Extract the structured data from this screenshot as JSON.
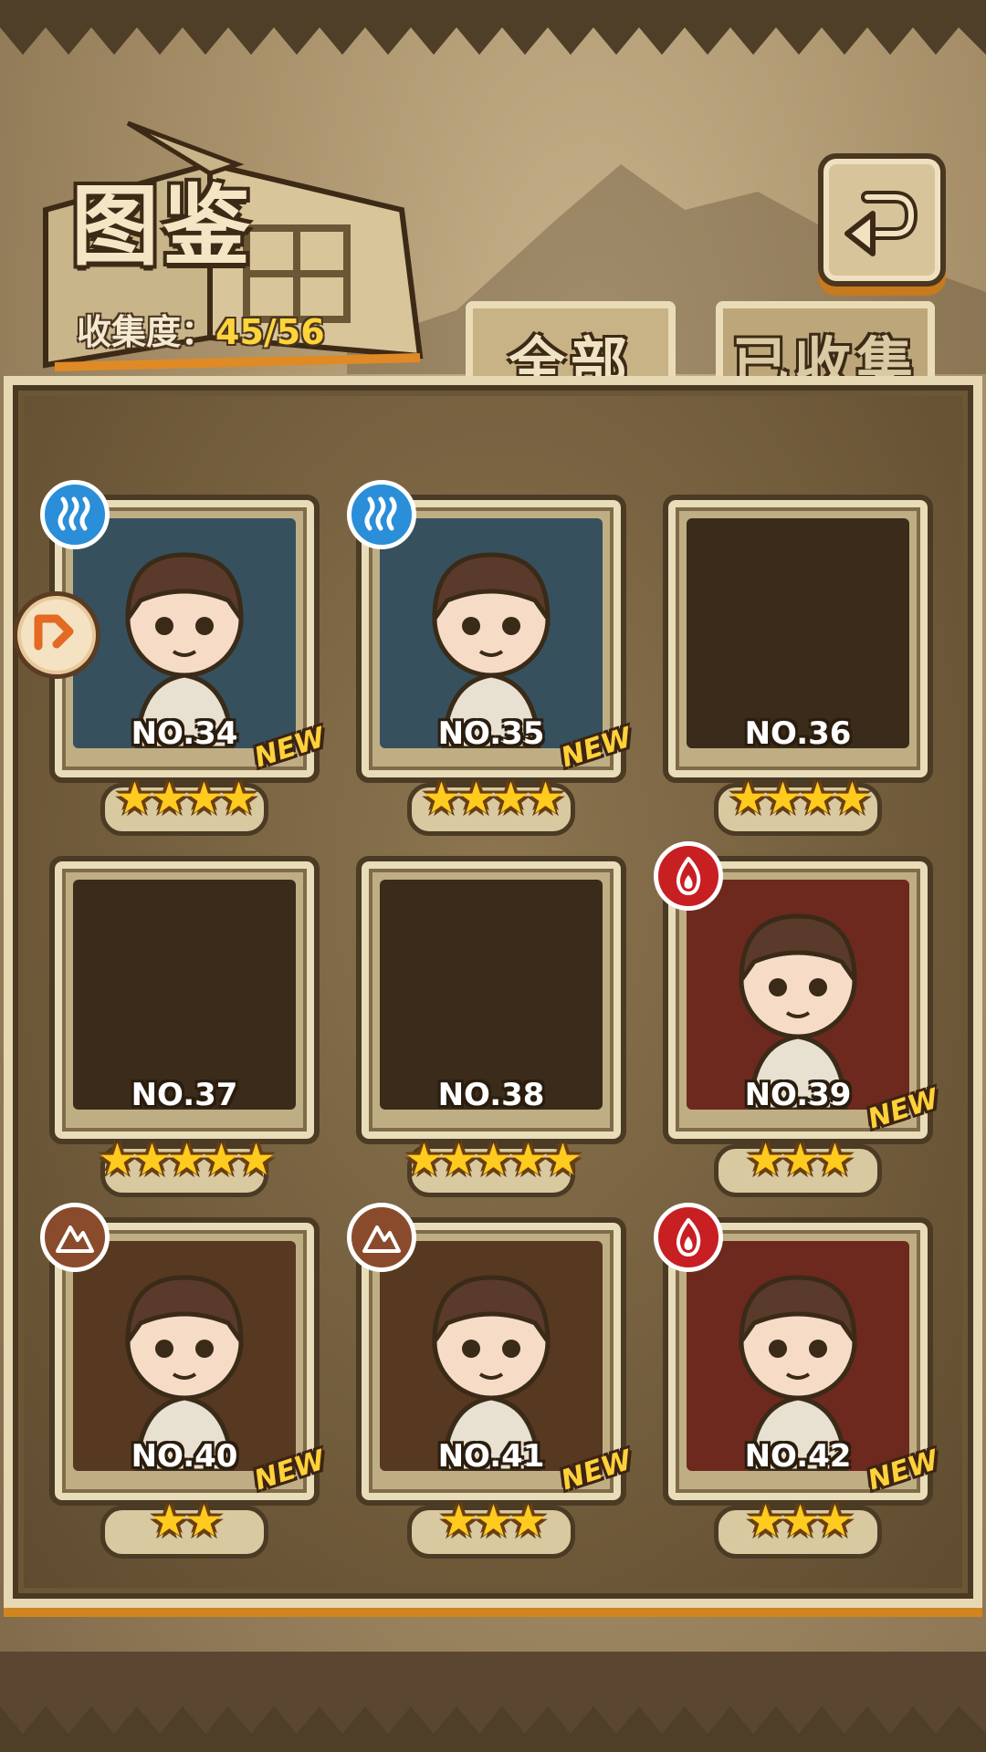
{
  "header": {
    "title": "图鉴",
    "collection_label": "收集度：",
    "collection_value": "45/56"
  },
  "tabs": [
    {
      "label": "全部",
      "selected": true
    },
    {
      "label": "已收集",
      "selected": false
    }
  ],
  "cards": [
    {
      "number": "NO.34",
      "stars": 4,
      "is_new": true,
      "new_label": "NEW",
      "element": "water-icon",
      "unlocked": true
    },
    {
      "number": "NO.35",
      "stars": 4,
      "is_new": true,
      "new_label": "NEW",
      "element": "water-icon",
      "unlocked": true
    },
    {
      "number": "NO.36",
      "stars": 4,
      "is_new": false,
      "element": null,
      "unlocked": false
    },
    {
      "number": "NO.37",
      "stars": 5,
      "is_new": false,
      "element": null,
      "unlocked": false
    },
    {
      "number": "NO.38",
      "stars": 5,
      "is_new": false,
      "element": null,
      "unlocked": false
    },
    {
      "number": "NO.39",
      "stars": 3,
      "is_new": true,
      "new_label": "NEW",
      "element": "fire-icon",
      "unlocked": true
    },
    {
      "number": "NO.40",
      "stars": 2,
      "is_new": true,
      "new_label": "NEW",
      "element": "earth-icon",
      "unlocked": true
    },
    {
      "number": "NO.41",
      "stars": 3,
      "is_new": true,
      "new_label": "NEW",
      "element": "earth-icon",
      "unlocked": true
    },
    {
      "number": "NO.42",
      "stars": 3,
      "is_new": true,
      "new_label": "NEW",
      "element": "fire-icon",
      "unlocked": true
    }
  ],
  "colors": {
    "accent_yellow": "#ffd43a",
    "water": "#2a8ed8",
    "fire": "#c81f23",
    "earth": "#8a4b2c"
  }
}
